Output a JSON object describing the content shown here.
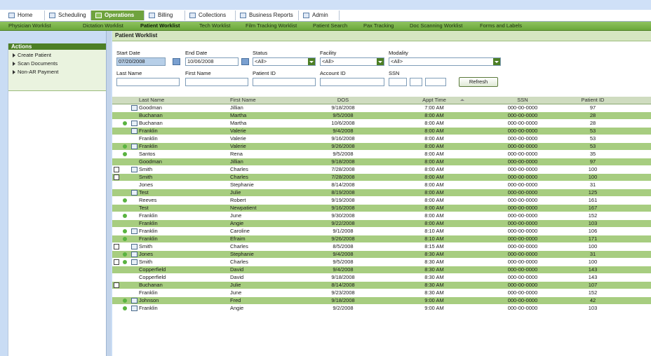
{
  "tabs": [
    {
      "label": "Home",
      "icon": "home-icon",
      "active": false
    },
    {
      "label": "Scheduling",
      "icon": "calendar-icon",
      "active": false
    },
    {
      "label": "Operations",
      "icon": "operations-icon",
      "active": true
    },
    {
      "label": "Billing",
      "icon": "billing-icon",
      "active": false
    },
    {
      "label": "Collections",
      "icon": "collections-icon",
      "active": false
    },
    {
      "label": "Business Reports",
      "icon": "reports-icon",
      "active": false
    },
    {
      "label": "Admin",
      "icon": "admin-icon",
      "active": false
    }
  ],
  "subnav": [
    {
      "label": "Physician Worklist",
      "active": false
    },
    {
      "label": "Dictation Worklist",
      "active": false
    },
    {
      "label": "Patient Worklist",
      "active": true
    },
    {
      "label": "Tech Worklist",
      "active": false
    },
    {
      "label": "Film Tracking Worklist",
      "active": false
    },
    {
      "label": "Patient Search",
      "active": false
    },
    {
      "label": "Pax Tracking",
      "active": false
    },
    {
      "label": "Doc Scanning Worklist",
      "active": false
    },
    {
      "label": "Forms and Labels",
      "active": false
    }
  ],
  "actions": {
    "title": "Actions",
    "items": [
      "Create Patient",
      "Scan Documents",
      "Non-AR Payment"
    ]
  },
  "worklist": {
    "title": "Patient Worklist",
    "start_date_label": "Start Date",
    "start_date_value": "07/20/2008",
    "end_date_label": "End Date",
    "end_date_value": "10/06/2008",
    "status_label": "Status",
    "status_value": "<All>",
    "facility_label": "Facility",
    "facility_value": "<All>",
    "modality_label": "Modality",
    "modality_value": "<All>",
    "last_name_label": "Last Name",
    "first_name_label": "First Name",
    "patient_id_label": "Patient ID",
    "account_id_label": "Account ID",
    "ssn_label": "SSN",
    "refresh_label": "Refresh"
  },
  "columns": [
    "Last Name",
    "First Name",
    "DOS",
    "Appt Time",
    "SSN",
    "Patient ID"
  ],
  "rows": [
    {
      "doc": false,
      "dot": false,
      "flow": true,
      "last": "Goodman",
      "first": "Jillian",
      "dos": "9/18/2008",
      "appt": "7:00 AM",
      "ssn": "000-00-0000",
      "pid": "97"
    },
    {
      "doc": false,
      "dot": false,
      "flow": false,
      "last": "Buchanan",
      "first": "Martha",
      "dos": "9/5/2008",
      "appt": "8:00 AM",
      "ssn": "000-00-0000",
      "pid": "28"
    },
    {
      "doc": false,
      "dot": true,
      "flow": true,
      "last": "Buchanan",
      "first": "Martha",
      "dos": "10/6/2008",
      "appt": "8:00 AM",
      "ssn": "000-00-0000",
      "pid": "28"
    },
    {
      "doc": false,
      "dot": false,
      "flow": true,
      "last": "Franklin",
      "first": "Valerie",
      "dos": "9/4/2008",
      "appt": "8:00 AM",
      "ssn": "000-00-0000",
      "pid": "53"
    },
    {
      "doc": false,
      "dot": false,
      "flow": false,
      "last": "Franklin",
      "first": "Valerie",
      "dos": "9/16/2008",
      "appt": "8:00 AM",
      "ssn": "000-00-0000",
      "pid": "53"
    },
    {
      "doc": false,
      "dot": true,
      "flow": true,
      "last": "Franklin",
      "first": "Valerie",
      "dos": "9/26/2008",
      "appt": "8:00 AM",
      "ssn": "000-00-0000",
      "pid": "53"
    },
    {
      "doc": false,
      "dot": true,
      "flow": false,
      "last": "Santos",
      "first": "Rena",
      "dos": "9/5/2008",
      "appt": "8:00 AM",
      "ssn": "000-00-0000",
      "pid": "35"
    },
    {
      "doc": false,
      "dot": false,
      "flow": false,
      "last": "Goodman",
      "first": "Jillian",
      "dos": "9/18/2008",
      "appt": "8:00 AM",
      "ssn": "000-00-0000",
      "pid": "97"
    },
    {
      "doc": true,
      "dot": false,
      "flow": true,
      "last": "Smith",
      "first": "Charles",
      "dos": "7/28/2008",
      "appt": "8:00 AM",
      "ssn": "000-00-0000",
      "pid": "100"
    },
    {
      "doc": true,
      "dot": false,
      "flow": false,
      "last": "Smith",
      "first": "Charles",
      "dos": "7/28/2008",
      "appt": "8:00 AM",
      "ssn": "000-00-0000",
      "pid": "100"
    },
    {
      "doc": false,
      "dot": false,
      "flow": false,
      "last": "Jones",
      "first": "Stephanie",
      "dos": "8/14/2008",
      "appt": "8:00 AM",
      "ssn": "000-00-0000",
      "pid": "31"
    },
    {
      "doc": false,
      "dot": false,
      "flow": true,
      "last": "Test",
      "first": "Julie",
      "dos": "8/19/2008",
      "appt": "8:00 AM",
      "ssn": "000-00-0000",
      "pid": "125"
    },
    {
      "doc": false,
      "dot": true,
      "flow": false,
      "last": "Reeves",
      "first": "Robert",
      "dos": "9/19/2008",
      "appt": "8:00 AM",
      "ssn": "000-00-0000",
      "pid": "161"
    },
    {
      "doc": false,
      "dot": false,
      "flow": false,
      "last": "Test",
      "first": "Newpatient",
      "dos": "9/16/2008",
      "appt": "8:00 AM",
      "ssn": "000-00-0000",
      "pid": "167"
    },
    {
      "doc": false,
      "dot": true,
      "flow": false,
      "last": "Franklin",
      "first": "June",
      "dos": "9/30/2008",
      "appt": "8:00 AM",
      "ssn": "000-00-0000",
      "pid": "152"
    },
    {
      "doc": false,
      "dot": false,
      "flow": false,
      "last": "Franklin",
      "first": "Angie",
      "dos": "9/22/2008",
      "appt": "8:00 AM",
      "ssn": "000-00-0000",
      "pid": "103"
    },
    {
      "doc": false,
      "dot": true,
      "flow": true,
      "last": "Franklin",
      "first": "Caroline",
      "dos": "9/1/2008",
      "appt": "8:10 AM",
      "ssn": "000-00-0000",
      "pid": "106"
    },
    {
      "doc": false,
      "dot": true,
      "flow": false,
      "last": "Franklin",
      "first": "Efraim",
      "dos": "9/26/2008",
      "appt": "8:10 AM",
      "ssn": "000-00-0000",
      "pid": "171"
    },
    {
      "doc": true,
      "dot": false,
      "flow": true,
      "last": "Smith",
      "first": "Charles",
      "dos": "8/5/2008",
      "appt": "8:15 AM",
      "ssn": "000-00-0000",
      "pid": "100"
    },
    {
      "doc": false,
      "dot": true,
      "flow": true,
      "last": "Jones",
      "first": "Stephanie",
      "dos": "9/4/2008",
      "appt": "8:30 AM",
      "ssn": "000-00-0000",
      "pid": "31"
    },
    {
      "doc": true,
      "dot": true,
      "flow": true,
      "last": "Smith",
      "first": "Charles",
      "dos": "9/5/2008",
      "appt": "8:30 AM",
      "ssn": "000-00-0000",
      "pid": "100"
    },
    {
      "doc": false,
      "dot": false,
      "flow": false,
      "last": "Copperfield",
      "first": "David",
      "dos": "9/4/2008",
      "appt": "8:30 AM",
      "ssn": "000-00-0000",
      "pid": "143"
    },
    {
      "doc": false,
      "dot": false,
      "flow": false,
      "last": "Copperfield",
      "first": "David",
      "dos": "9/18/2008",
      "appt": "8:30 AM",
      "ssn": "000-00-0000",
      "pid": "143"
    },
    {
      "doc": true,
      "dot": false,
      "flow": false,
      "last": "Buchanan",
      "first": "Julie",
      "dos": "8/14/2008",
      "appt": "8:30 AM",
      "ssn": "000-00-0000",
      "pid": "107"
    },
    {
      "doc": false,
      "dot": false,
      "flow": false,
      "last": "Franklin",
      "first": "June",
      "dos": "9/23/2008",
      "appt": "8:30 AM",
      "ssn": "000-00-0000",
      "pid": "152"
    },
    {
      "doc": false,
      "dot": true,
      "flow": true,
      "last": "Johnson",
      "first": "Fred",
      "dos": "9/18/2008",
      "appt": "9:00 AM",
      "ssn": "000-00-0000",
      "pid": "42"
    },
    {
      "doc": false,
      "dot": true,
      "flow": true,
      "last": "Franklin",
      "first": "Angie",
      "dos": "9/2/2008",
      "appt": "9:00 AM",
      "ssn": "000-00-0000",
      "pid": "103"
    }
  ]
}
